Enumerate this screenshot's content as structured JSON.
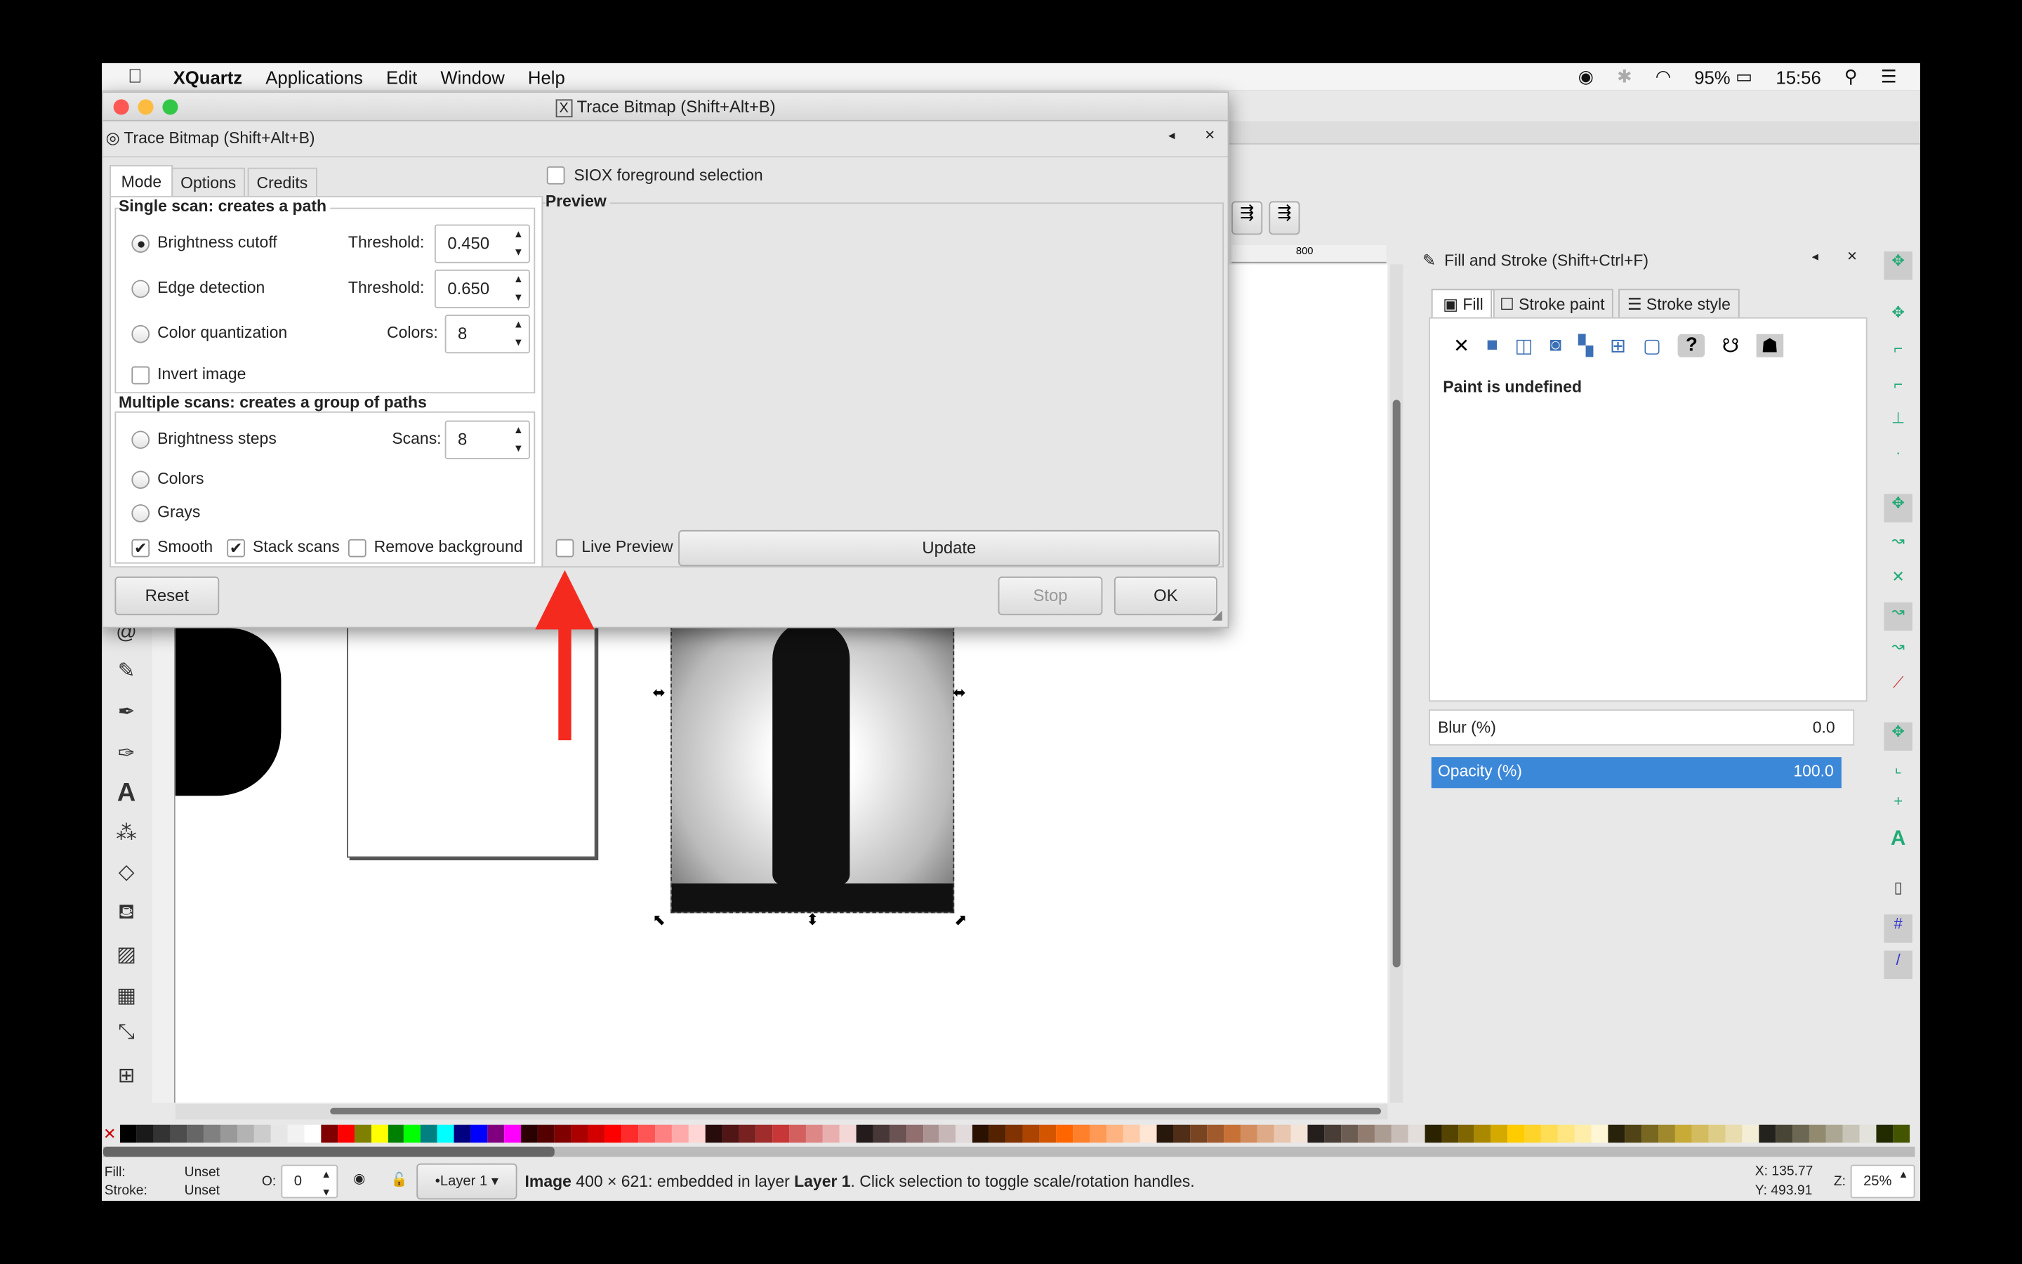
{
  "menubar": {
    "app": "XQuartz",
    "items": [
      "Applications",
      "Edit",
      "Window",
      "Help"
    ],
    "battery": "95%",
    "time": "15:56"
  },
  "dialog": {
    "window_title": "Trace Bitmap (Shift+Alt+B)",
    "panel_title": "Trace Bitmap (Shift+Alt+B)",
    "tabs": [
      "Mode",
      "Options",
      "Credits"
    ],
    "active_tab": "Mode",
    "siox_label": "SIOX foreground selection",
    "preview_label": "Preview",
    "single_scan": {
      "title": "Single scan: creates a path",
      "brightness_cutoff": "Brightness cutoff",
      "threshold_label": "Threshold:",
      "brightness_threshold": "0.450",
      "edge_detection": "Edge detection",
      "edge_threshold": "0.650",
      "color_quantization": "Color quantization",
      "colors_label": "Colors:",
      "colors_value": "8",
      "invert_image": "Invert image"
    },
    "multi_scan": {
      "title": "Multiple scans: creates a group of paths",
      "brightness_steps": "Brightness steps",
      "scans_label": "Scans:",
      "scans_value": "8",
      "colors": "Colors",
      "grays": "Grays",
      "smooth": "Smooth",
      "stack_scans": "Stack scans",
      "remove_background": "Remove background"
    },
    "live_preview": "Live Preview",
    "update": "Update",
    "reset": "Reset",
    "stop": "Stop",
    "ok": "OK",
    "selected_mode": "Brightness cutoff",
    "smooth_checked": true,
    "stack_checked": true
  },
  "fill_stroke": {
    "title": "Fill and Stroke (Shift+Ctrl+F)",
    "tabs": [
      "Fill",
      "Stroke paint",
      "Stroke style"
    ],
    "paint_status": "Paint is undefined",
    "blur_label": "Blur (%)",
    "blur_value": "0.0",
    "opacity_label": "Opacity (%)",
    "opacity_value": "100.0"
  },
  "ruler": {
    "mark": "800"
  },
  "status": {
    "fill_label": "Fill:",
    "fill_value": "Unset",
    "stroke_label": "Stroke:",
    "stroke_value": "Unset",
    "opacity_label": "O:",
    "opacity_value": "0",
    "layer": "•Layer 1",
    "message_prefix": "Image",
    "message": " 400 × 621: embedded in layer ",
    "layer_bold": "Layer 1",
    "message_suffix": ". Click selection to toggle scale/rotation handles.",
    "x_label": "X:",
    "x": "135.77",
    "y_label": "Y:",
    "y": "493.91",
    "zoom_label": "Z:",
    "zoom": "25%"
  },
  "colors": {
    "accent": "#3b87d8",
    "arrow": "#f52a1f"
  },
  "palette": [
    "#000000",
    "#1a1a1a",
    "#333333",
    "#4d4d4d",
    "#666666",
    "#808080",
    "#999999",
    "#b3b3b3",
    "#cccccc",
    "#e6e6e6",
    "#f2f2f2",
    "#ffffff",
    "#800000",
    "#ff0000",
    "#808000",
    "#ffff00",
    "#008000",
    "#00ff00",
    "#008080",
    "#00ffff",
    "#000080",
    "#0000ff",
    "#800080",
    "#ff00ff",
    "#2b0000",
    "#550000",
    "#800000",
    "#aa0000",
    "#d40000",
    "#ff0000",
    "#ff2a2a",
    "#ff5555",
    "#ff8080",
    "#ffaaaa",
    "#ffd5d5",
    "#280b0b",
    "#501616",
    "#782121",
    "#a02c2c",
    "#c83737",
    "#d35f5f",
    "#de8787",
    "#e9afaf",
    "#f4d7d7",
    "#241c1c",
    "#483737",
    "#6c5353",
    "#916f6f",
    "#ac9393",
    "#c8b7b7",
    "#e3dbdb",
    "#2b1100",
    "#552200",
    "#803300",
    "#aa4400",
    "#d45500",
    "#ff6600",
    "#ff7f2a",
    "#ff9955",
    "#ffb380",
    "#ffccaa",
    "#ffe6d5",
    "#28170b",
    "#502d16",
    "#784421",
    "#a05a2c",
    "#c87137",
    "#d38d5f",
    "#deaa87",
    "#e9c6af",
    "#f4e3d7",
    "#241f1c",
    "#483e37",
    "#6c5d53",
    "#917c6f",
    "#ac9d93",
    "#c8beb7",
    "#e3dedb",
    "#2b2200",
    "#554400",
    "#806600",
    "#aa8800",
    "#d4aa00",
    "#ffcc00",
    "#ffd42a",
    "#ffdd55",
    "#ffe680",
    "#ffeeaa",
    "#fff6d5",
    "#28220b",
    "#504416",
    "#786721",
    "#a0892c",
    "#c8ab37",
    "#d3bc5f",
    "#decd87",
    "#e9ddaf",
    "#f4eed7",
    "#24221c",
    "#484537",
    "#6c6753",
    "#918a6f",
    "#aca793",
    "#c8c4b7",
    "#e3e2db",
    "#222b00",
    "#445500"
  ]
}
